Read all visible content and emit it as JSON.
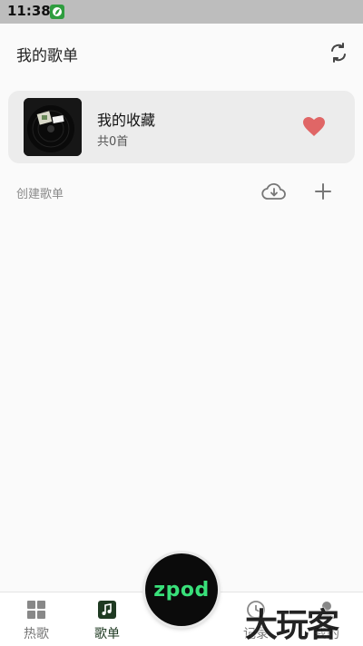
{
  "status_bar": {
    "time": "11:38"
  },
  "header": {
    "title": "我的歌单"
  },
  "favorites": {
    "title": "我的收藏",
    "count": "共0首"
  },
  "section": {
    "create_label": "创建歌单"
  },
  "center_button": {
    "label": "zpod"
  },
  "tabs": [
    {
      "label": "热歌",
      "icon": "grid-icon"
    },
    {
      "label": "歌单",
      "icon": "playlist-icon"
    },
    {
      "label": "记录",
      "icon": "history-icon"
    },
    {
      "label": "我的",
      "icon": "person-icon"
    }
  ],
  "watermark": {
    "text": "大玩客"
  },
  "colors": {
    "accent_green": "#39e07a",
    "heart_red": "#e06666",
    "active_tab": "#1f3a22"
  }
}
